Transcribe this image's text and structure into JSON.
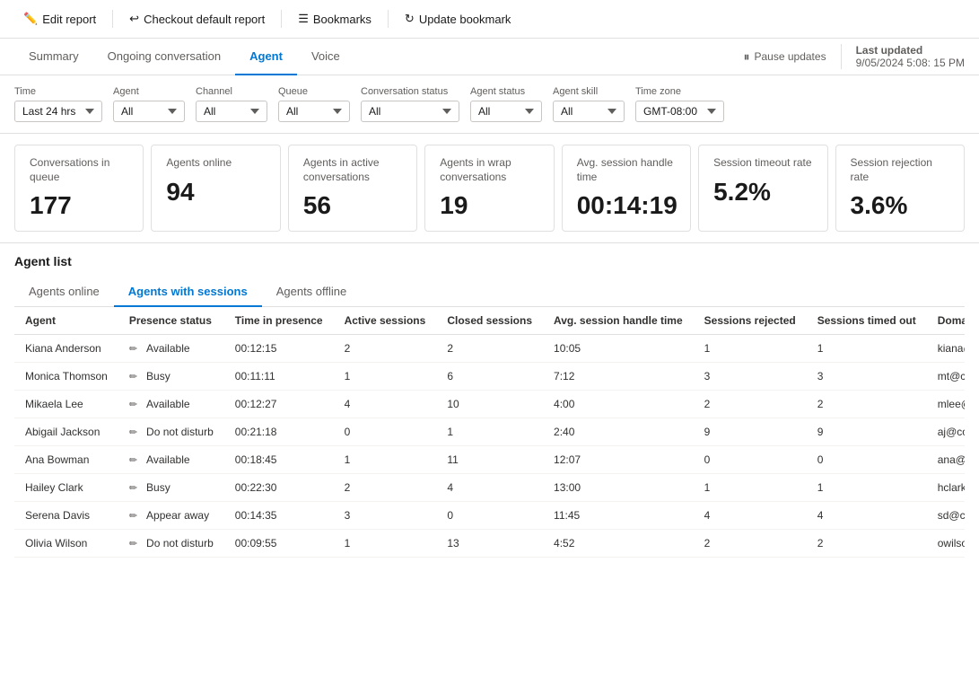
{
  "toolbar": {
    "edit_report": "Edit report",
    "checkout_default": "Checkout default report",
    "bookmarks": "Bookmarks",
    "update_bookmark": "Update bookmark"
  },
  "nav": {
    "tabs": [
      "Summary",
      "Ongoing conversation",
      "Agent",
      "Voice"
    ],
    "active_tab": "Agent",
    "pause_label": "Pause updates",
    "last_updated_label": "Last updated",
    "last_updated_value": "9/05/2024 5:08: 15 PM"
  },
  "filters": {
    "time_label": "Time",
    "time_value": "Last 24 hrs",
    "agent_label": "Agent",
    "agent_value": "All",
    "channel_label": "Channel",
    "channel_value": "All",
    "queue_label": "Queue",
    "queue_value": "All",
    "conv_status_label": "Conversation status",
    "conv_status_value": "All",
    "agent_status_label": "Agent status",
    "agent_status_value": "All",
    "agent_skill_label": "Agent skill",
    "agent_skill_value": "All",
    "timezone_label": "Time zone",
    "timezone_value": "GMT-08:00"
  },
  "metrics": [
    {
      "title": "Conversations in queue",
      "value": "177"
    },
    {
      "title": "Agents online",
      "value": "94"
    },
    {
      "title": "Agents in active conversations",
      "value": "56"
    },
    {
      "title": "Agents in wrap conversations",
      "value": "19"
    },
    {
      "title": "Avg. session handle time",
      "value": "00:14:19"
    },
    {
      "title": "Session timeout rate",
      "value": "5.2%"
    },
    {
      "title": "Session rejection rate",
      "value": "3.6%"
    }
  ],
  "agent_list": {
    "section_title": "Agent list",
    "sub_tabs": [
      "Agents online",
      "Agents with sessions",
      "Agents offline"
    ],
    "active_sub_tab": "Agents with sessions",
    "columns": [
      "Agent",
      "Presence status",
      "Time in presence",
      "Active sessions",
      "Closed sessions",
      "Avg. session handle time",
      "Sessions rejected",
      "Sessions timed out",
      "Domain name"
    ],
    "rows": [
      {
        "name": "Kiana Anderson",
        "status": "Available",
        "time_presence": "00:12:15",
        "active": "2",
        "closed": "2",
        "avg_handle": "10:05",
        "rejected": "1",
        "timed_out": "1",
        "domain": "kiana@contoso.cc"
      },
      {
        "name": "Monica Thomson",
        "status": "Busy",
        "time_presence": "00:11:11",
        "active": "1",
        "closed": "6",
        "avg_handle": "7:12",
        "rejected": "3",
        "timed_out": "3",
        "domain": "mt@contoso.com"
      },
      {
        "name": "Mikaela Lee",
        "status": "Available",
        "time_presence": "00:12:27",
        "active": "4",
        "closed": "10",
        "avg_handle": "4:00",
        "rejected": "2",
        "timed_out": "2",
        "domain": "mlee@contoso.co"
      },
      {
        "name": "Abigail Jackson",
        "status": "Do not disturb",
        "time_presence": "00:21:18",
        "active": "0",
        "closed": "1",
        "avg_handle": "2:40",
        "rejected": "9",
        "timed_out": "9",
        "domain": "aj@contoso.com"
      },
      {
        "name": "Ana Bowman",
        "status": "Available",
        "time_presence": "00:18:45",
        "active": "1",
        "closed": "11",
        "avg_handle": "12:07",
        "rejected": "0",
        "timed_out": "0",
        "domain": "ana@contoso.com"
      },
      {
        "name": "Hailey Clark",
        "status": "Busy",
        "time_presence": "00:22:30",
        "active": "2",
        "closed": "4",
        "avg_handle": "13:00",
        "rejected": "1",
        "timed_out": "1",
        "domain": "hclark@contoso.c"
      },
      {
        "name": "Serena Davis",
        "status": "Appear away",
        "time_presence": "00:14:35",
        "active": "3",
        "closed": "0",
        "avg_handle": "11:45",
        "rejected": "4",
        "timed_out": "4",
        "domain": "sd@contoso.com"
      },
      {
        "name": "Olivia Wilson",
        "status": "Do not disturb",
        "time_presence": "00:09:55",
        "active": "1",
        "closed": "13",
        "avg_handle": "4:52",
        "rejected": "2",
        "timed_out": "2",
        "domain": "owilson@contoso"
      }
    ]
  }
}
